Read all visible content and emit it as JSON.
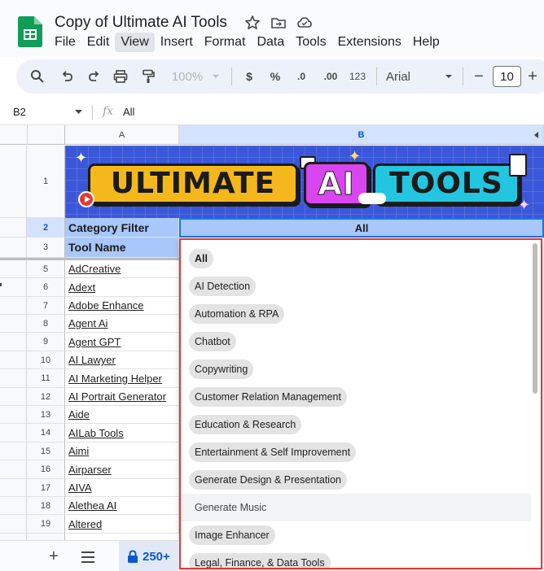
{
  "app": {
    "doc_title": "Copy of Ultimate AI Tools",
    "menu": [
      "File",
      "Edit",
      "View",
      "Insert",
      "Format",
      "Data",
      "Tools",
      "Extensions",
      "Help"
    ],
    "active_menu": "View"
  },
  "toolbar": {
    "zoom": "100%",
    "currency_label": "$",
    "percent_label": "%",
    "decrease_decimal_label": ".0",
    "increase_decimal_label": ".00",
    "number_format_label": "123",
    "font": "Arial",
    "font_size": "10",
    "decrease_font_label": "−",
    "increase_font_label": "+"
  },
  "formula_bar": {
    "cell_ref": "B2",
    "value": "All"
  },
  "grid": {
    "columns": [
      "A",
      "B"
    ],
    "banner": {
      "word1": "ULTIMATE",
      "word2": "AI",
      "word3": "TOOLS"
    },
    "rows": [
      {
        "num": "1",
        "a": ""
      },
      {
        "num": "2",
        "a": "Category Filter"
      },
      {
        "num": "3",
        "a": "Tool Name"
      },
      {
        "num": "5",
        "a": "AdCreative"
      },
      {
        "num": "6",
        "a": "Adext"
      },
      {
        "num": "7",
        "a": "Adobe Enhance"
      },
      {
        "num": "8",
        "a": "Agent Ai"
      },
      {
        "num": "9",
        "a": "Agent GPT"
      },
      {
        "num": "10",
        "a": "AI Lawyer"
      },
      {
        "num": "11",
        "a": "AI Marketing Helper"
      },
      {
        "num": "12",
        "a": "AI Portrait Generator"
      },
      {
        "num": "13",
        "a": "Aide"
      },
      {
        "num": "14",
        "a": "AILab Tools"
      },
      {
        "num": "15",
        "a": "Aimi"
      },
      {
        "num": "16",
        "a": "Airparser"
      },
      {
        "num": "17",
        "a": "AIVA"
      },
      {
        "num": "18",
        "a": "Alethea AI"
      },
      {
        "num": "19",
        "a": "Altered"
      }
    ],
    "b2_value": "All"
  },
  "dropdown": {
    "options": [
      "All",
      "AI Detection",
      "Automation & RPA",
      "Chatbot",
      "Copywriting",
      "Customer Relation Management",
      "Education & Research",
      "Entertainment & Self Improvement",
      "Generate Design & Presentation",
      "Generate Music",
      "Image Enhancer",
      "Legal, Finance, & Data Tools"
    ],
    "selected": "All",
    "hovered": "Generate Music"
  },
  "bottom": {
    "sheet_tab_label": "250+"
  },
  "colors": {
    "accent": "#0b57d0",
    "header_fill": "#a8c7fa",
    "highlight_border": "#e53935",
    "sheets_green": "#0f9d58"
  }
}
